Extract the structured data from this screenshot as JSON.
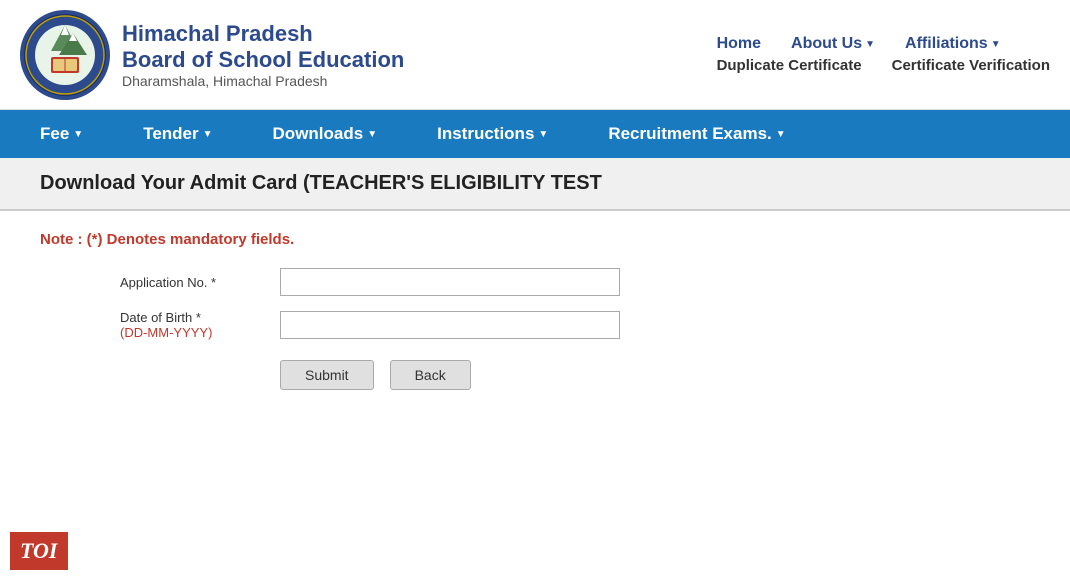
{
  "header": {
    "logo_alt": "Board of School Education Logo",
    "org_line1": "Himachal Pradesh",
    "org_line2": "Board of School Education",
    "org_line3": "Dharamshala, Himachal Pradesh"
  },
  "top_nav": {
    "row1": [
      {
        "label": "Home",
        "has_arrow": false
      },
      {
        "label": "About Us",
        "has_arrow": true
      },
      {
        "label": "Affiliations",
        "has_arrow": true
      }
    ],
    "row2": [
      {
        "label": "Duplicate Certificate",
        "has_arrow": false
      },
      {
        "label": "Certificate Verification",
        "has_arrow": false
      }
    ]
  },
  "blue_nav": {
    "items": [
      {
        "label": "Fee",
        "has_arrow": true
      },
      {
        "label": "Tender",
        "has_arrow": true
      },
      {
        "label": "Downloads",
        "has_arrow": true
      },
      {
        "label": "Instructions",
        "has_arrow": true
      },
      {
        "label": "Recruitment Exams.",
        "has_arrow": true
      }
    ]
  },
  "page_title": "Download Your Admit Card (TEACHER'S ELIGIBILITY TEST",
  "note": "Note  : (*) Denotes mandatory fields.",
  "form": {
    "app_no_label": "Application No. *",
    "dob_label_main": "Date of Birth *",
    "dob_label_sub": "(DD-MM-YYYY)",
    "app_no_placeholder": "",
    "dob_placeholder": "",
    "submit_label": "Submit",
    "back_label": "Back"
  },
  "toi_badge": "TOI"
}
